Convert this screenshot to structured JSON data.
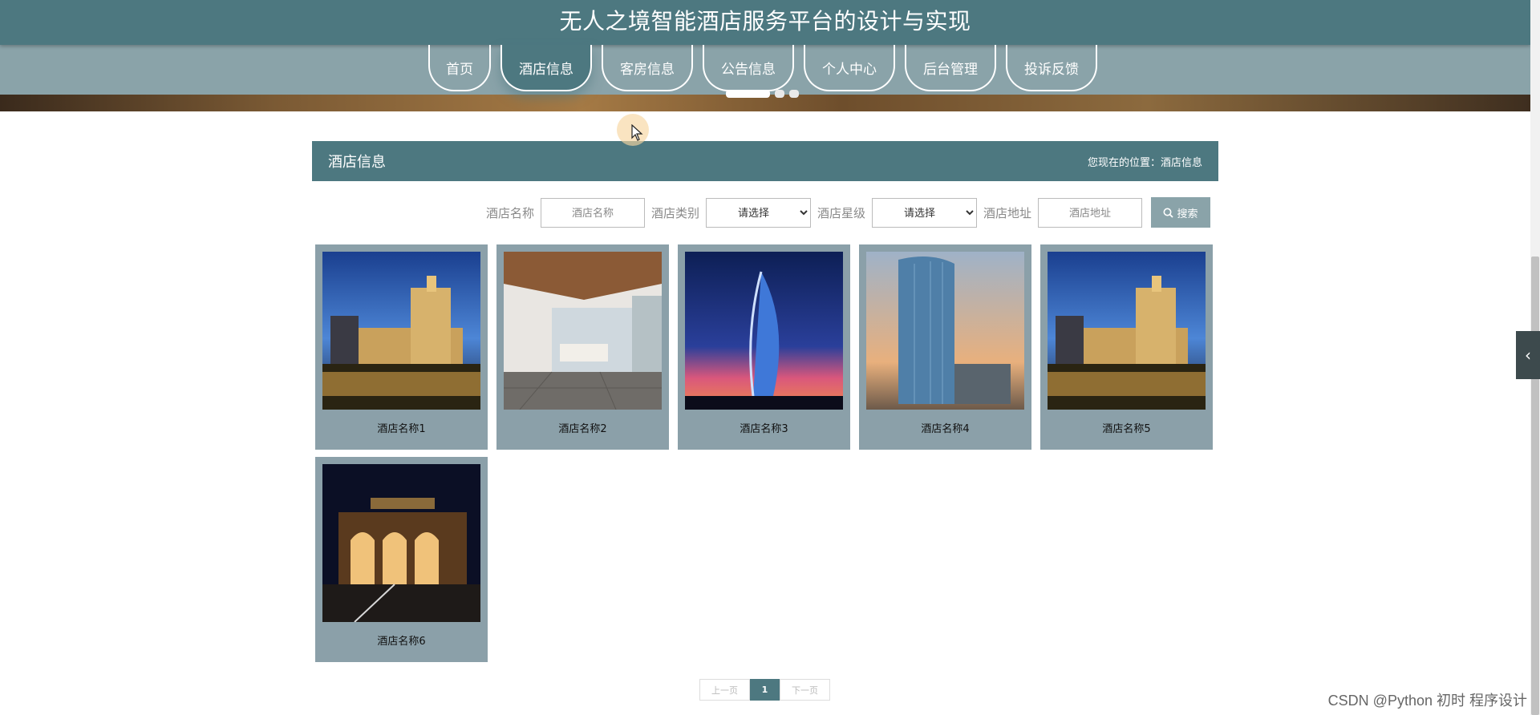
{
  "site": {
    "title": "无人之境智能酒店服务平台的设计与实现"
  },
  "nav": {
    "items": [
      {
        "label": "首页"
      },
      {
        "label": "酒店信息"
      },
      {
        "label": "客房信息"
      },
      {
        "label": "公告信息"
      },
      {
        "label": "个人中心"
      },
      {
        "label": "后台管理"
      },
      {
        "label": "投诉反馈"
      }
    ],
    "active_index": 1
  },
  "panel": {
    "title": "酒店信息",
    "breadcrumb": "您现在的位置：酒店信息"
  },
  "search": {
    "name_label": "酒店名称",
    "name_placeholder": "酒店名称",
    "type_label": "酒店类别",
    "type_value": "请选择",
    "star_label": "酒店星级",
    "star_value": "请选择",
    "address_label": "酒店地址",
    "address_placeholder": "酒店地址",
    "button_label": "搜索"
  },
  "hotels": [
    {
      "name": "酒店名称1",
      "image": "venetian-resort-night"
    },
    {
      "name": "酒店名称2",
      "image": "bright-interior-room"
    },
    {
      "name": "酒店名称3",
      "image": "sail-tower-dusk"
    },
    {
      "name": "酒店名称4",
      "image": "glass-tower-sunset"
    },
    {
      "name": "酒店名称5",
      "image": "venetian-resort-night"
    },
    {
      "name": "酒店名称6",
      "image": "arched-facade-night"
    }
  ],
  "pagination": {
    "prev": "上一页",
    "current": "1",
    "next": "下一页"
  },
  "watermark": "CSDN @Python 初时 程序设计",
  "colors": {
    "primary": "#4d7880",
    "secondary": "#8aa3a9",
    "card": "#8ba0a9"
  }
}
